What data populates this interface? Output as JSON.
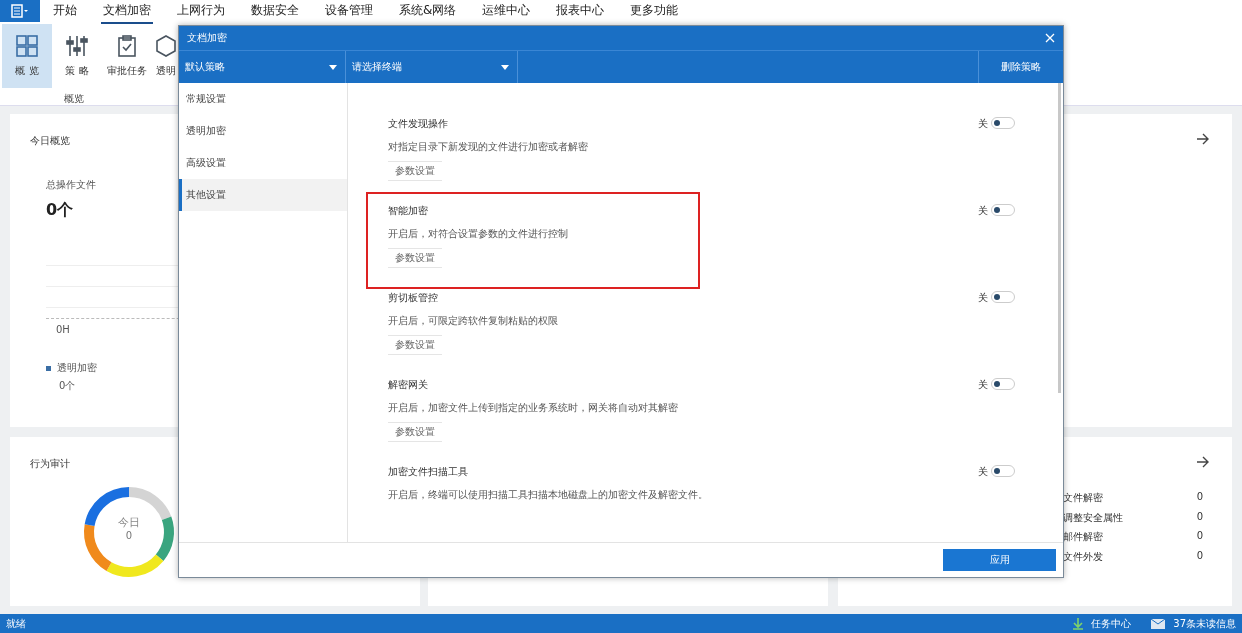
{
  "app_menu": {
    "kind": "menu"
  },
  "menu_tabs": [
    {
      "label": "开始",
      "selected": false
    },
    {
      "label": "文档加密",
      "selected": true
    },
    {
      "label": "上网行为",
      "selected": false
    },
    {
      "label": "数据安全",
      "selected": false
    },
    {
      "label": "设备管理",
      "selected": false
    },
    {
      "label": "系统&网络",
      "selected": false
    },
    {
      "label": "运维中心",
      "selected": false
    },
    {
      "label": "报表中心",
      "selected": false
    },
    {
      "label": "更多功能",
      "selected": false
    }
  ],
  "ribbon": {
    "buttons": [
      {
        "label": "概 览",
        "kind": "grid",
        "selected": true
      },
      {
        "label": "策 略",
        "kind": "sliders",
        "selected": false
      },
      {
        "label": "审批任务",
        "kind": "clipboard",
        "selected": false
      },
      {
        "label": "透明",
        "kind": "cube",
        "selected": false
      }
    ],
    "group_label": "概览"
  },
  "overview_card": {
    "title": "今日概览",
    "metric_label": "总操作文件",
    "metric_value": "0个",
    "axis_label": "0H",
    "legend": [
      {
        "label": "透明加密",
        "value": "0个",
        "color": "#3a6ea5"
      }
    ]
  },
  "audit_card": {
    "title": "行为审计",
    "donut_label": "今日",
    "donut_value": "0",
    "stats": [
      {
        "label": "文件解密",
        "value": "0"
      },
      {
        "label": "调整安全属性",
        "value": "0"
      },
      {
        "label": "邮件解密",
        "value": "0"
      },
      {
        "label": "文件外发",
        "value": "0"
      }
    ]
  },
  "dialog": {
    "title": "文档加密",
    "policy_select": "默认策略",
    "terminal_select": "请选择终端",
    "delete_button": "删除策略",
    "nav": [
      {
        "label": "常规设置",
        "selected": false
      },
      {
        "label": "透明加密",
        "selected": false
      },
      {
        "label": "高级设置",
        "selected": false
      },
      {
        "label": "其他设置",
        "selected": true
      }
    ],
    "settings": [
      {
        "title": "文件发现操作",
        "description": "对指定目录下新发现的文件进行加密或者解密",
        "button": "参数设置",
        "toggle_label": "关",
        "on": false,
        "highlighted": false
      },
      {
        "title": "智能加密",
        "description": "开启后，对符合设置参数的文件进行控制",
        "button": "参数设置",
        "toggle_label": "关",
        "on": false,
        "highlighted": true
      },
      {
        "title": "剪切板管控",
        "description": "开启后，可限定跨软件复制粘贴的权限",
        "button": "参数设置",
        "toggle_label": "关",
        "on": false,
        "highlighted": false
      },
      {
        "title": "解密网关",
        "description": "开启后，加密文件上传到指定的业务系统时，网关将自动对其解密",
        "button": "参数设置",
        "toggle_label": "关",
        "on": false,
        "highlighted": false
      },
      {
        "title": "加密文件扫描工具",
        "description": "开启后，终端可以使用扫描工具扫描本地磁盘上的加密文件及解密文件。",
        "toggle_label": "关",
        "on": false,
        "highlighted": false
      }
    ],
    "apply_button": "应用"
  },
  "status_bar": {
    "left": "就绪",
    "task_center": "任务中心",
    "messages": "37条未读信息"
  }
}
